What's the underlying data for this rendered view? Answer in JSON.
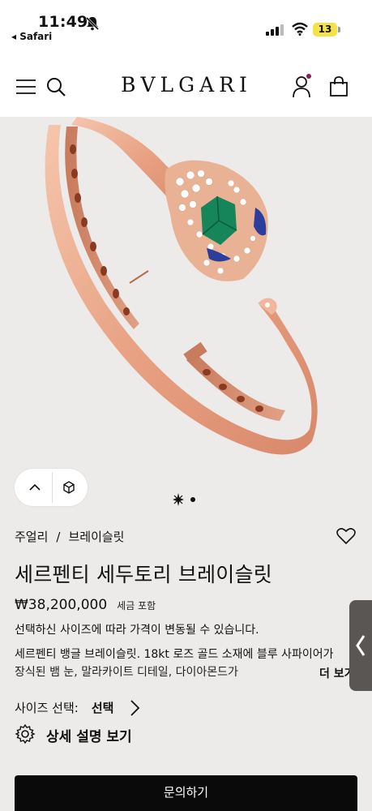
{
  "status_bar": {
    "time": "11:49",
    "back_app": "◂ Safari",
    "battery": "13"
  },
  "nav": {
    "logo": "BVLGARI"
  },
  "breadcrumb": {
    "item1": "주얼리",
    "separator": "/",
    "item2": "브레이슬릿"
  },
  "product": {
    "title": "세르펜티 세두토리 브레이슬릿",
    "price": "₩38,200,000",
    "tax_note": "세금 포함",
    "price_note": "선택하신 사이즈에 따라 가격이 변동될 수 있습니다.",
    "desc_line1": "세르펜티 뱅글 브레이슬릿. 18kt 로즈 골드 소재에 블루 사파이어가",
    "desc_line2": "장식된 뱀 눈, 말라카이트 디테일, 다이아몬드가",
    "more_label": "더 보기"
  },
  "size": {
    "label": "사이즈 선택:",
    "value": "선택"
  },
  "details": {
    "label": "상세 설명 보기"
  },
  "cta": {
    "label": "문의하기"
  },
  "carousel": {
    "slide_count": 2,
    "active_index": 0
  },
  "colors": {
    "background": "#ecebea",
    "gold": "#e8a98a",
    "malachite": "#16855a",
    "sapphire": "#2b3e9a",
    "button": "#0a0a0a",
    "account_badge": "#8b1e55"
  }
}
